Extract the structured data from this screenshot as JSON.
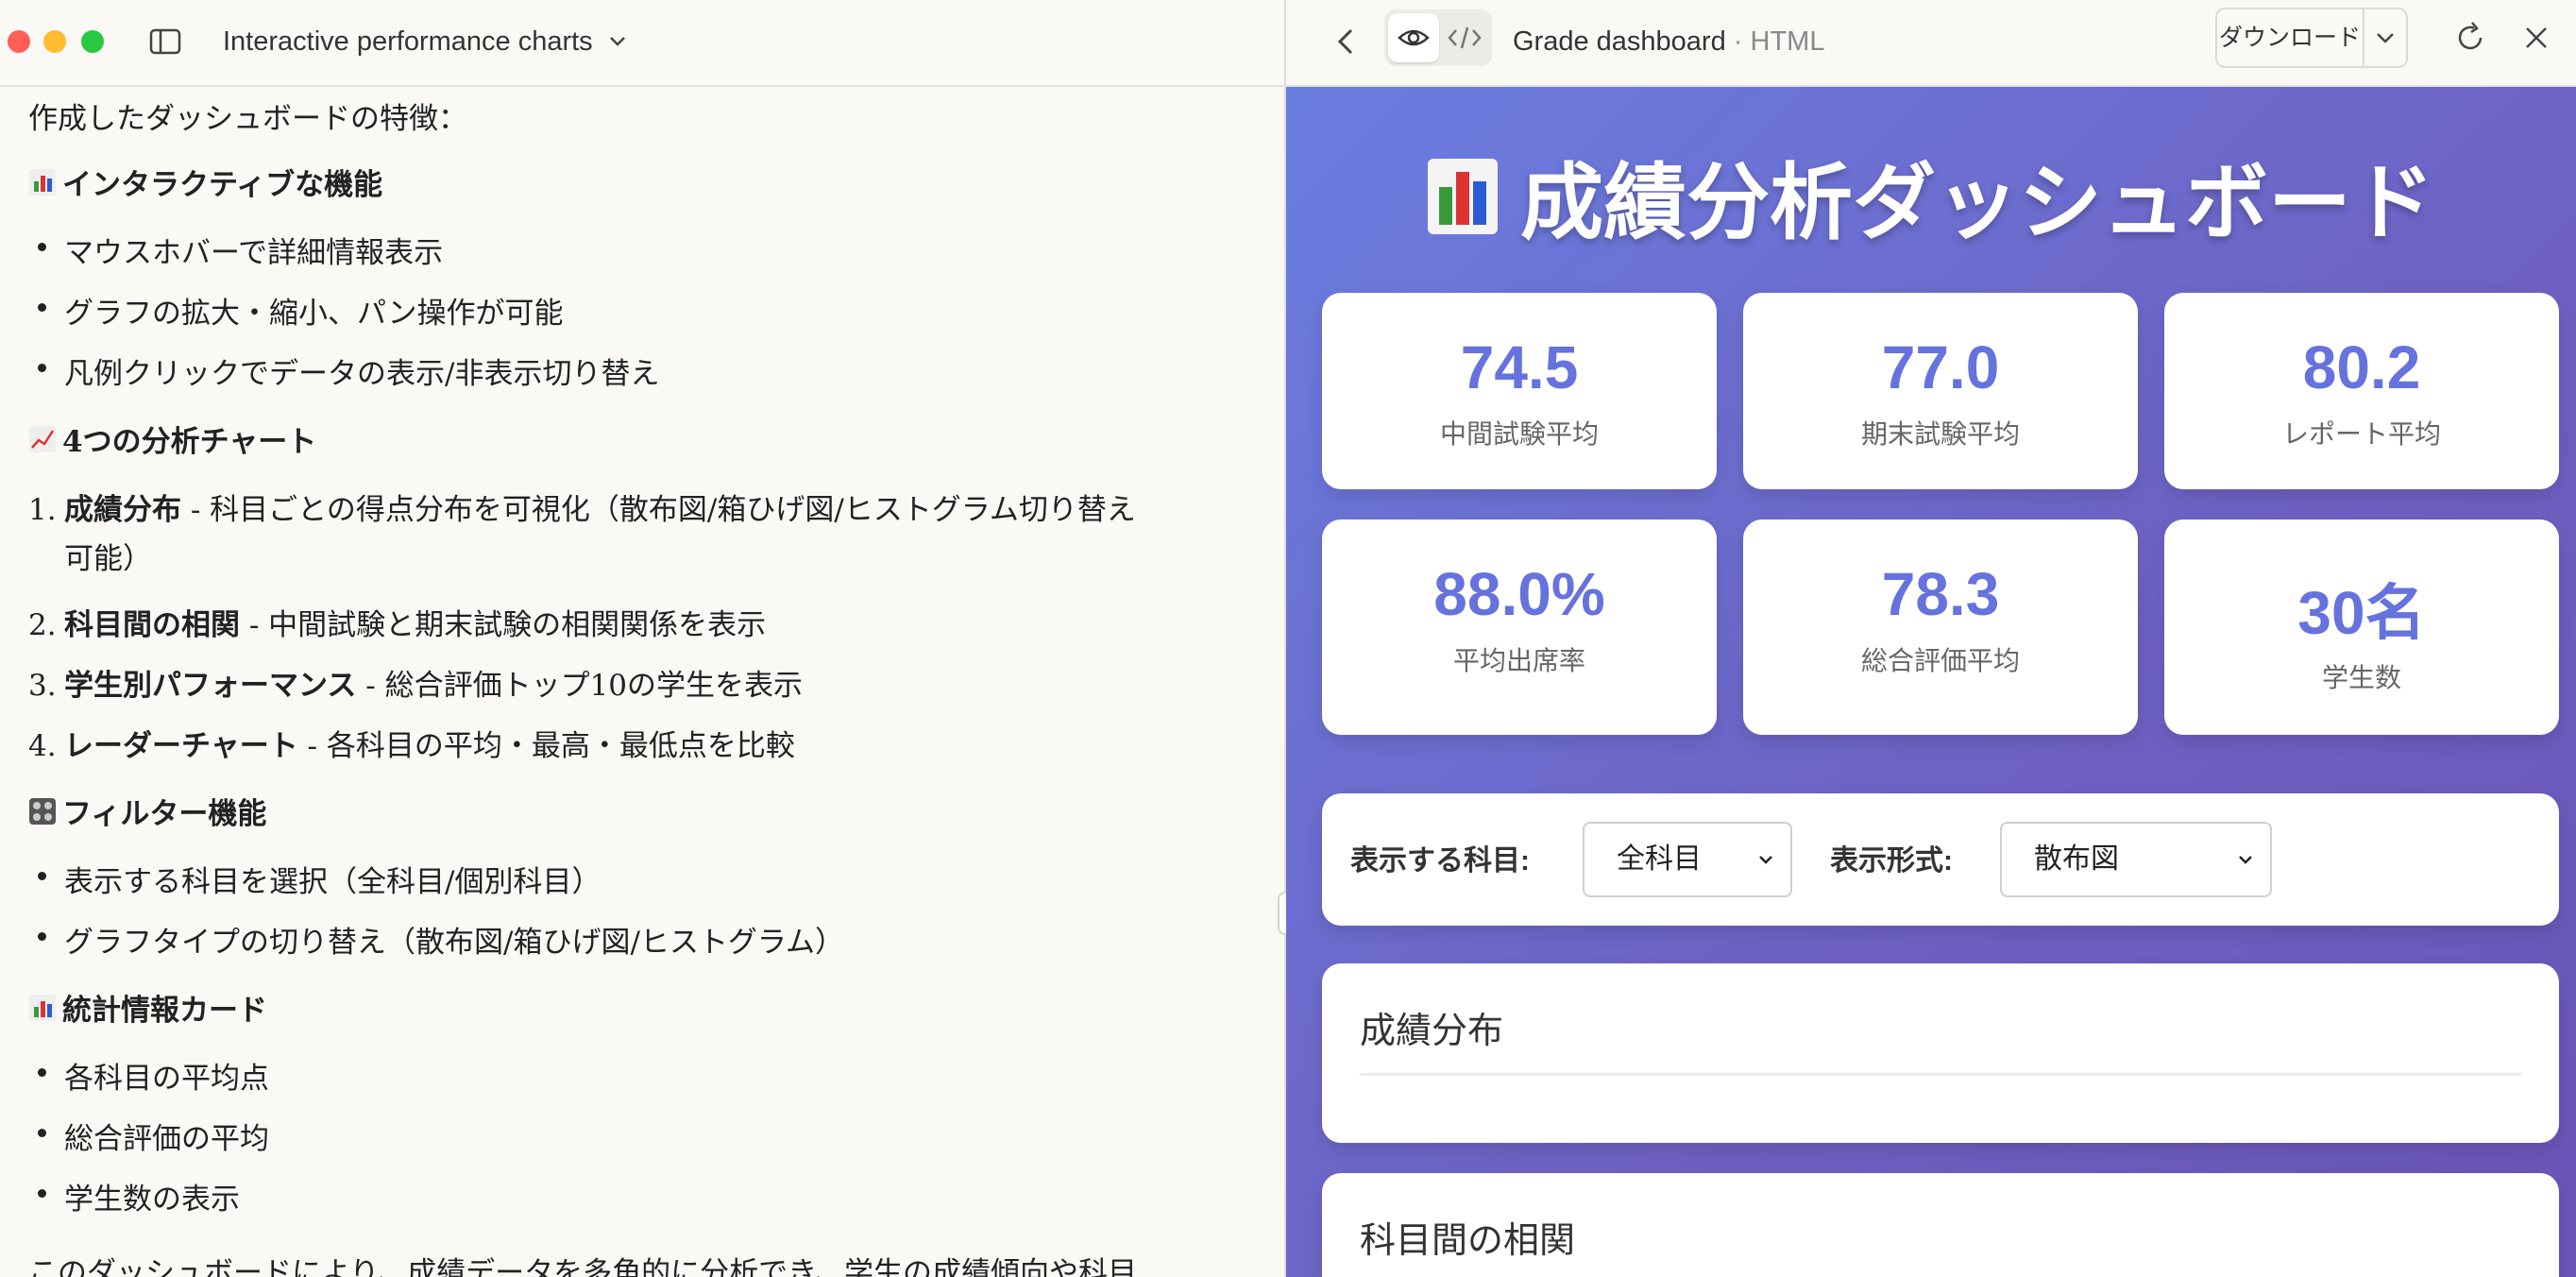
{
  "window": {
    "conversation_title": "Interactive performance charts"
  },
  "content": {
    "intro": "作成したダッシュボードの特徴：",
    "sections": [
      {
        "heading": "インタラクティブな機能",
        "items": [
          "マウスホバーで詳細情報表示",
          "グラフの拡大・縮小、パン操作が可能",
          "凡例クリックでデータの表示/非表示切り替え"
        ]
      },
      {
        "heading": "4つの分析チャート",
        "ordered": [
          {
            "num": "1.",
            "bold": "成績分布",
            "text": " - 科目ごとの得点分布を可視化（散布図/箱ひげ図/ヒストグラム切り替え",
            "cont": "可能）"
          },
          {
            "num": "2.",
            "bold": "科目間の相関",
            "text": " - 中間試験と期末試験の相関関係を表示"
          },
          {
            "num": "3.",
            "bold": "学生別パフォーマンス",
            "text": " - 総合評価トップ10の学生を表示"
          },
          {
            "num": "4.",
            "bold": "レーダーチャート",
            "text": " - 各科目の平均・最高・最低点を比較"
          }
        ]
      },
      {
        "heading": "フィルター機能",
        "items": [
          "表示する科目を選択（全科目/個別科目）",
          "グラフタイプの切り替え（散布図/箱ひげ図/ヒストグラム）"
        ]
      },
      {
        "heading": "統計情報カード",
        "items": [
          "各科目の平均点",
          "総合評価の平均",
          "学生数の表示"
        ]
      }
    ],
    "closing": "このダッシュボードにより、成績データを多角的に分析でき、学生の成績傾向や科目"
  },
  "artifact": {
    "title": "Grade dashboard",
    "separator": " · ",
    "type": "HTML",
    "download_label": "ダウンロード"
  },
  "dashboard": {
    "title": "成績分析ダッシュボード",
    "stats": [
      {
        "value": "74.5",
        "label": "中間試験平均"
      },
      {
        "value": "77.0",
        "label": "期末試験平均"
      },
      {
        "value": "80.2",
        "label": "レポート平均"
      },
      {
        "value": "88.0%",
        "label": "平均出席率"
      },
      {
        "value": "78.3",
        "label": "総合評価平均"
      },
      {
        "value": "30名",
        "label": "学生数"
      }
    ],
    "filters": {
      "subject_label": "表示する科目:",
      "subject_value": "全科目",
      "type_label": "表示形式:",
      "type_value": "散布図"
    },
    "charts": [
      {
        "title": "成績分布"
      },
      {
        "title": "科目間の相関"
      }
    ]
  },
  "colors": {
    "accent": "#6672dd",
    "gradient_start": "#6a7ee0",
    "gradient_end": "#6a55b6"
  }
}
